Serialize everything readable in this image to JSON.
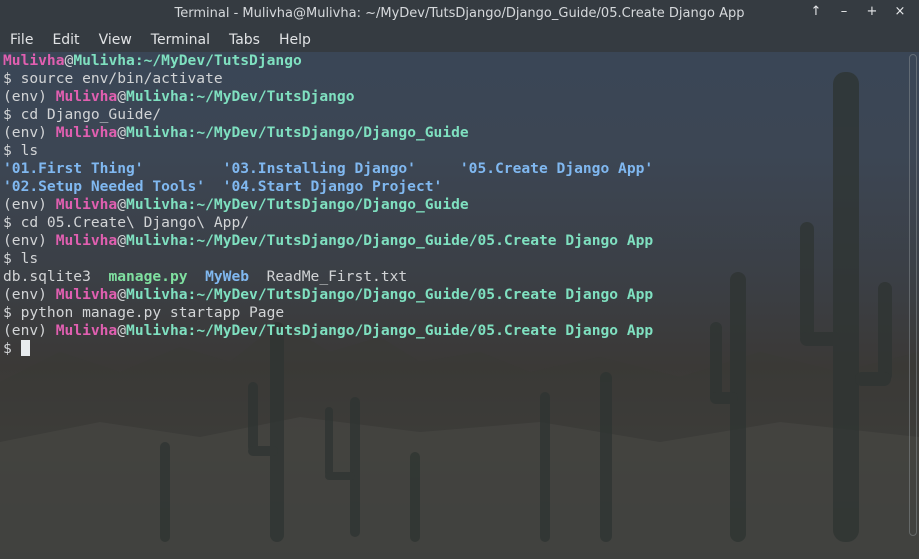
{
  "window": {
    "title": "Terminal - Mulivha@Mulivha: ~/MyDev/TutsDjango/Django_Guide/05.Create Django App",
    "controls": [
      "↑",
      "–",
      "+",
      "×"
    ]
  },
  "menu": [
    "File",
    "Edit",
    "View",
    "Terminal",
    "Tabs",
    "Help"
  ],
  "terminal": {
    "lines": [
      [
        {
          "t": "Mulivha",
          "c": "u"
        },
        {
          "t": "@",
          "c": "at"
        },
        {
          "t": "Mulivha",
          "c": "h"
        },
        {
          "t": ":~/MyDev/TutsDjango",
          "c": "p"
        }
      ],
      [
        {
          "t": "$ source env/bin/activate",
          "c": ""
        }
      ],
      [
        {
          "t": "(env) ",
          "c": ""
        },
        {
          "t": "Mulivha",
          "c": "u"
        },
        {
          "t": "@",
          "c": "at"
        },
        {
          "t": "Mulivha",
          "c": "h"
        },
        {
          "t": ":~/MyDev/TutsDjango",
          "c": "p"
        }
      ],
      [
        {
          "t": "$ cd Django_Guide/",
          "c": ""
        }
      ],
      [
        {
          "t": "(env) ",
          "c": ""
        },
        {
          "t": "Mulivha",
          "c": "u"
        },
        {
          "t": "@",
          "c": "at"
        },
        {
          "t": "Mulivha",
          "c": "h"
        },
        {
          "t": ":~/MyDev/TutsDjango/Django_Guide",
          "c": "p"
        }
      ],
      [
        {
          "t": "$ ls",
          "c": ""
        }
      ],
      [
        {
          "t": "'01.First Thing'         '03.Installing Django'     '05.Create Django App'",
          "c": "dir"
        }
      ],
      [
        {
          "t": "'02.Setup Needed Tools'  '04.Start Django Project'",
          "c": "dir"
        }
      ],
      [
        {
          "t": "(env) ",
          "c": ""
        },
        {
          "t": "Mulivha",
          "c": "u"
        },
        {
          "t": "@",
          "c": "at"
        },
        {
          "t": "Mulivha",
          "c": "h"
        },
        {
          "t": ":~/MyDev/TutsDjango/Django_Guide",
          "c": "p"
        }
      ],
      [
        {
          "t": "$ cd 05.Create\\ Django\\ App/",
          "c": ""
        }
      ],
      [
        {
          "t": "(env) ",
          "c": ""
        },
        {
          "t": "Mulivha",
          "c": "u"
        },
        {
          "t": "@",
          "c": "at"
        },
        {
          "t": "Mulivha",
          "c": "h"
        },
        {
          "t": ":~/MyDev/TutsDjango/Django_Guide/05.Create Django App",
          "c": "p"
        }
      ],
      [
        {
          "t": "$ ls",
          "c": ""
        }
      ],
      [
        {
          "t": "db.sqlite3  ",
          "c": ""
        },
        {
          "t": "manage.py",
          "c": "exe"
        },
        {
          "t": "  ",
          "c": ""
        },
        {
          "t": "MyWeb",
          "c": "dir"
        },
        {
          "t": "  ReadMe_First.txt",
          "c": ""
        }
      ],
      [
        {
          "t": "(env) ",
          "c": ""
        },
        {
          "t": "Mulivha",
          "c": "u"
        },
        {
          "t": "@",
          "c": "at"
        },
        {
          "t": "Mulivha",
          "c": "h"
        },
        {
          "t": ":~/MyDev/TutsDjango/Django_Guide/05.Create Django App",
          "c": "p"
        }
      ],
      [
        {
          "t": "$ python manage.py startapp Page",
          "c": ""
        }
      ],
      [
        {
          "t": "(env) ",
          "c": ""
        },
        {
          "t": "Mulivha",
          "c": "u"
        },
        {
          "t": "@",
          "c": "at"
        },
        {
          "t": "Mulivha",
          "c": "h"
        },
        {
          "t": ":~/MyDev/TutsDjango/Django_Guide/05.Create Django App",
          "c": "p"
        }
      ],
      [
        {
          "t": "$ ",
          "c": ""
        },
        {
          "cursor": true
        }
      ]
    ]
  }
}
